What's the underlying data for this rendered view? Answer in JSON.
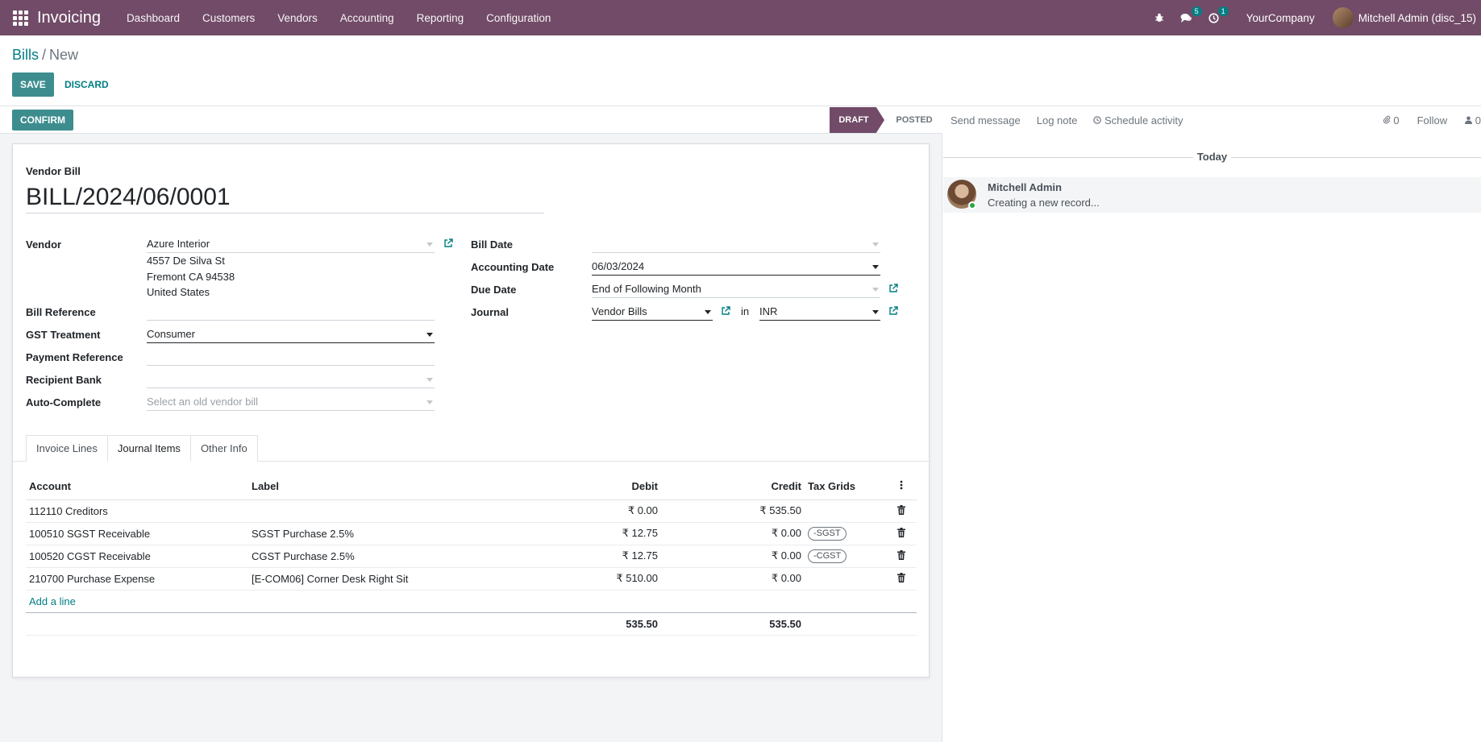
{
  "navbar": {
    "app_title": "Invoicing",
    "menu": [
      "Dashboard",
      "Customers",
      "Vendors",
      "Accounting",
      "Reporting",
      "Configuration"
    ],
    "messages_count": "5",
    "activities_count": "1",
    "company": "YourCompany",
    "user": "Mitchell Admin (disc_15)"
  },
  "breadcrumb": {
    "parent": "Bills",
    "separator": "/",
    "current": "New"
  },
  "buttons": {
    "save": "SAVE",
    "discard": "DISCARD",
    "confirm": "CONFIRM"
  },
  "statusbar": {
    "stages": [
      "DRAFT",
      "POSTED"
    ],
    "active": "DRAFT"
  },
  "form": {
    "doc_type": "Vendor Bill",
    "name": "BILL/2024/06/0001",
    "left": {
      "vendor_label": "Vendor",
      "vendor_value": "Azure Interior",
      "address": [
        "4557 De Silva St",
        "Fremont CA 94538",
        "United States"
      ],
      "bill_reference_label": "Bill Reference",
      "bill_reference_value": "",
      "gst_treatment_label": "GST Treatment",
      "gst_treatment_value": "Consumer",
      "payment_reference_label": "Payment Reference",
      "payment_reference_value": "",
      "recipient_bank_label": "Recipient Bank",
      "recipient_bank_value": "",
      "auto_complete_label": "Auto-Complete",
      "auto_complete_placeholder": "Select an old vendor bill"
    },
    "right": {
      "bill_date_label": "Bill Date",
      "bill_date_value": "",
      "accounting_date_label": "Accounting Date",
      "accounting_date_value": "06/03/2024",
      "due_date_label": "Due Date",
      "due_date_value": "End of Following Month",
      "journal_label": "Journal",
      "journal_value": "Vendor Bills",
      "in_label": "in",
      "currency_value": "INR"
    }
  },
  "tabs": [
    "Invoice Lines",
    "Journal Items",
    "Other Info"
  ],
  "active_tab": "Journal Items",
  "journal_items": {
    "columns": [
      "Account",
      "Label",
      "Debit",
      "Credit",
      "Tax Grids"
    ],
    "rows": [
      {
        "account": "112110 Creditors",
        "label": "",
        "debit": "₹ 0.00",
        "credit": "₹ 535.50",
        "tax_grid": ""
      },
      {
        "account": "100510 SGST Receivable",
        "label": "SGST Purchase 2.5%",
        "debit": "₹ 12.75",
        "credit": "₹ 0.00",
        "tax_grid": "-SGST"
      },
      {
        "account": "100520 CGST Receivable",
        "label": "CGST Purchase 2.5%",
        "debit": "₹ 12.75",
        "credit": "₹ 0.00",
        "tax_grid": "-CGST"
      },
      {
        "account": "210700 Purchase Expense",
        "label": "[E-COM06] Corner Desk Right Sit",
        "debit": "₹ 510.00",
        "credit": "₹ 0.00",
        "tax_grid": ""
      }
    ],
    "add_line": "Add a line",
    "total_debit": "535.50",
    "total_credit": "535.50"
  },
  "chatter": {
    "send_message": "Send message",
    "log_note": "Log note",
    "schedule_activity": "Schedule activity",
    "attachments_count": "0",
    "follow": "Follow",
    "followers_count": "0",
    "day_separator": "Today",
    "message_author": "Mitchell Admin",
    "message_body": "Creating a new record..."
  },
  "colors": {
    "brand": "#714b67",
    "accent": "#017e84",
    "button": "#3d8d8f"
  }
}
